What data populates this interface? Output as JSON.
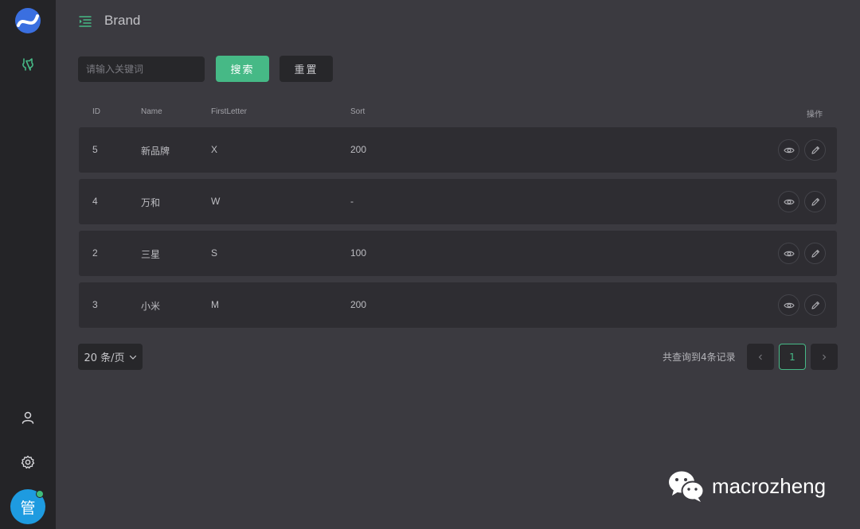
{
  "page": {
    "title": "Brand"
  },
  "search": {
    "placeholder": "请输入关键词",
    "search_label": "搜索",
    "reset_label": "重置"
  },
  "table": {
    "columns": {
      "id": "ID",
      "name": "Name",
      "first_letter": "FirstLetter",
      "sort": "Sort",
      "actions": "操作"
    },
    "rows": [
      {
        "id": "5",
        "name": "新品牌",
        "first_letter": "X",
        "sort": "200"
      },
      {
        "id": "4",
        "name": "万和",
        "first_letter": "W",
        "sort": "-"
      },
      {
        "id": "2",
        "name": "三星",
        "first_letter": "S",
        "sort": "100"
      },
      {
        "id": "3",
        "name": "小米",
        "first_letter": "M",
        "sort": "200"
      }
    ]
  },
  "pagination": {
    "page_size": "20 条/页",
    "total_text": "共查询到4条记录",
    "current_page": "1"
  },
  "user": {
    "avatar_text": "管"
  },
  "watermark": {
    "text": "macrozheng"
  },
  "colors": {
    "accent": "#46b986",
    "sidebar": "#242427",
    "background": "#3b3a40",
    "row": "#2e2d32",
    "avatar": "#1e9be0"
  },
  "icons": {
    "logo": "logo-icon",
    "github": "github-icon",
    "menu": "menu-fold-icon",
    "user": "user-icon",
    "settings": "gear-icon",
    "view": "eye-icon",
    "edit": "pencil-icon"
  }
}
